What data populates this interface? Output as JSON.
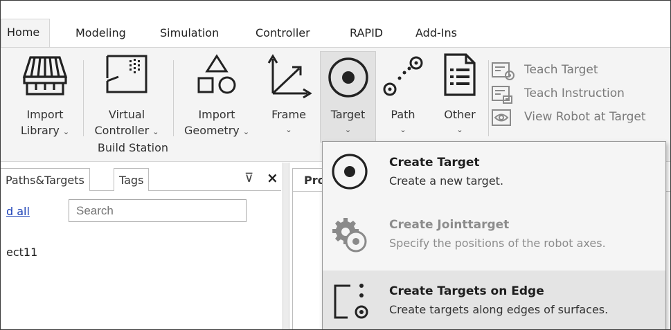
{
  "tabs": [
    {
      "label": "Home",
      "active": true
    },
    {
      "label": "Modeling"
    },
    {
      "label": "Simulation"
    },
    {
      "label": "Controller"
    },
    {
      "label": "RAPID"
    },
    {
      "label": "Add-Ins"
    }
  ],
  "ribbon": {
    "import_library": {
      "line1": "Import",
      "line2": "Library",
      "icon": "library-icon"
    },
    "virtual_controller": {
      "line1": "Virtual",
      "line2": "Controller",
      "icon": "controller-icon"
    },
    "group_label": "Build Station",
    "import_geometry": {
      "line1": "Import",
      "line2": "Geometry",
      "icon": "geometry-icon"
    },
    "frame": {
      "label": "Frame",
      "icon": "frame-axes-icon"
    },
    "target": {
      "label": "Target",
      "icon": "target-icon"
    },
    "path": {
      "label": "Path",
      "icon": "path-icon"
    },
    "other": {
      "label": "Other",
      "icon": "document-list-icon"
    },
    "teach_target": {
      "label": "Teach Target",
      "icon": "teach-target-icon"
    },
    "teach_instruction": {
      "label": "Teach Instruction",
      "icon": "teach-instruction-icon"
    },
    "view_robot_at_target": {
      "label": "View Robot at Target",
      "icon": "view-robot-icon"
    },
    "chevron": "⌄"
  },
  "left_panel": {
    "tabs": [
      "Paths&Targets",
      "Tags"
    ],
    "pin_glyph": "⊽",
    "close_glyph": "×",
    "expand_link": "d all",
    "search_placeholder": "Search",
    "tree_item": "ect11"
  },
  "right_doc": {
    "tab_label": "Pro"
  },
  "dropdown": {
    "items": [
      {
        "title": "Create Target",
        "description": "Create a new target.",
        "icon": "target-icon",
        "disabled": false
      },
      {
        "title": "Create Jointtarget",
        "description": "Specify the positions of the robot axes.",
        "icon": "gear-target-icon",
        "disabled": true
      },
      {
        "title": "Create Targets on Edge",
        "description": "Create targets along edges of surfaces.",
        "icon": "edge-target-icon",
        "disabled": false,
        "highlighted": true
      }
    ]
  }
}
